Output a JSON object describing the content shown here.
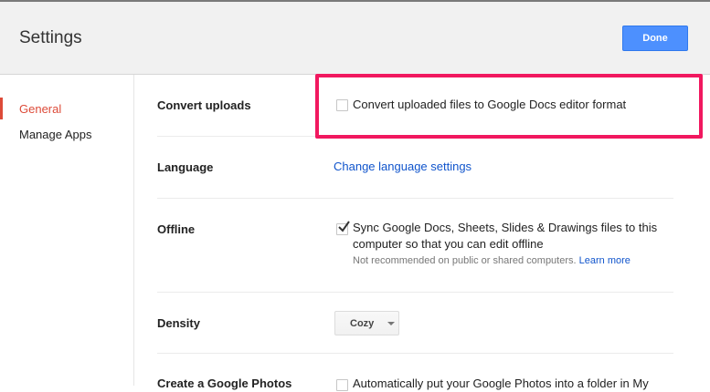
{
  "header": {
    "title": "Settings",
    "done_label": "Done"
  },
  "sidebar": {
    "items": [
      {
        "label": "General",
        "active": true
      },
      {
        "label": "Manage Apps",
        "active": false
      }
    ]
  },
  "sections": {
    "convert_uploads": {
      "label": "Convert uploads",
      "checked": false,
      "option_text": "Convert uploaded files to Google Docs editor format"
    },
    "language": {
      "label": "Language",
      "link_text": "Change language settings"
    },
    "offline": {
      "label": "Offline",
      "checked": true,
      "option_line1": "Sync Google Docs, Sheets, Slides & Drawings files to this",
      "option_line2": "computer so that you can edit offline",
      "note_text": "Not recommended on public or shared computers.",
      "learn_more": "Learn more"
    },
    "density": {
      "label": "Density",
      "selected": "Cozy"
    },
    "photos": {
      "label": "Create a Google Photos",
      "checked": false,
      "option_text": "Automatically put your Google Photos into a folder in My"
    }
  },
  "colors": {
    "accent": "#4d90fe",
    "active_nav": "#dd4b39",
    "link": "#1155cc",
    "highlight": "#f1185f"
  }
}
